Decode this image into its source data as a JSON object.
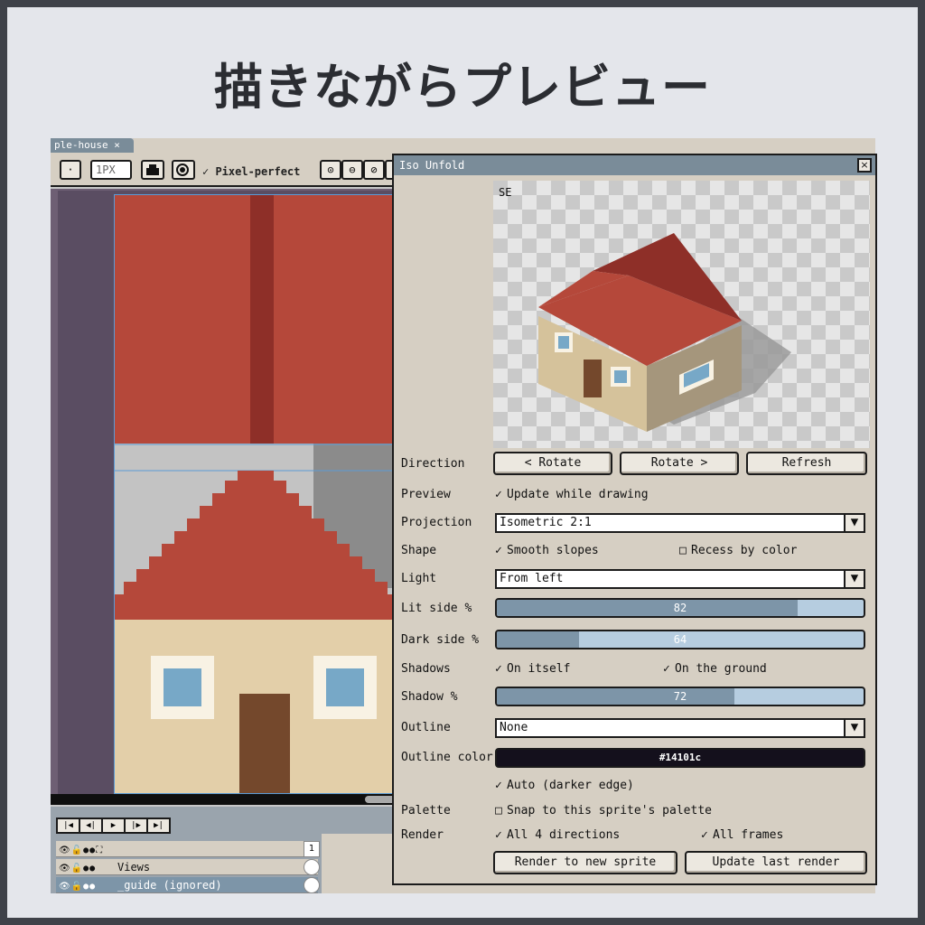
{
  "headline": "描きながらプレビュー",
  "document_tab": "ple-house ×",
  "toolbar": {
    "dot_button": "·",
    "brush_size": "1PX",
    "pixel_perfect_label": "Pixel-perfect",
    "pixel_perfect_checked": true
  },
  "timeline": {
    "controls": [
      "|◀",
      "◀|",
      "▶",
      "|▶",
      "▶|"
    ],
    "frame_number": "1",
    "layers": [
      {
        "icons": "👁🔓●●⛶",
        "name": "",
        "selected": false
      },
      {
        "icons": "👁🔓●●",
        "name": "Views",
        "selected": false
      },
      {
        "icons": "👁🔓●●",
        "name": "_guide (ignored)",
        "selected": true
      }
    ]
  },
  "dialog": {
    "title": "Iso Unfold",
    "close_label": "×",
    "preview_label": "SE",
    "direction": {
      "label": "Direction",
      "rotate_left": "< Rotate",
      "rotate_right": "Rotate >",
      "refresh": "Refresh"
    },
    "preview": {
      "label": "Preview",
      "option": "Update while drawing",
      "checked": true
    },
    "projection": {
      "label": "Projection",
      "value": "Isometric 2:1"
    },
    "shape": {
      "label": "Shape",
      "smooth": "Smooth slopes",
      "smooth_checked": true,
      "recess": "Recess by color",
      "recess_checked": false
    },
    "light": {
      "label": "Light",
      "value": "From left"
    },
    "lit_side": {
      "label": "Lit side %",
      "value": 82
    },
    "dark_side": {
      "label": "Dark side %",
      "value": 64
    },
    "shadows": {
      "label": "Shadows",
      "on_itself": "On itself",
      "on_itself_checked": true,
      "on_ground": "On the ground",
      "on_ground_checked": true
    },
    "shadow_pct": {
      "label": "Shadow %",
      "value": 72
    },
    "outline": {
      "label": "Outline",
      "value": "None"
    },
    "outline_color": {
      "label": "Outline color",
      "value": "#14101c"
    },
    "auto": {
      "option": "Auto (darker edge)",
      "checked": true
    },
    "palette": {
      "label": "Palette",
      "option": "Snap to this sprite's palette",
      "checked": false
    },
    "render": {
      "label": "Render",
      "all_directions": "All 4 directions",
      "all_directions_checked": true,
      "all_frames": "All frames",
      "all_frames_checked": true
    },
    "render_new_button": "Render to new sprite",
    "update_last_button": "Update last render"
  },
  "colors": {
    "roof": "#b5483a",
    "roof_dark": "#8e2f28",
    "wall": "#e3cfa9",
    "door": "#74482c",
    "window_frame": "#f8f2e4",
    "window_glass": "#77a8c7",
    "title_bar": "#7a8c99",
    "panel": "#d6cfc3"
  }
}
